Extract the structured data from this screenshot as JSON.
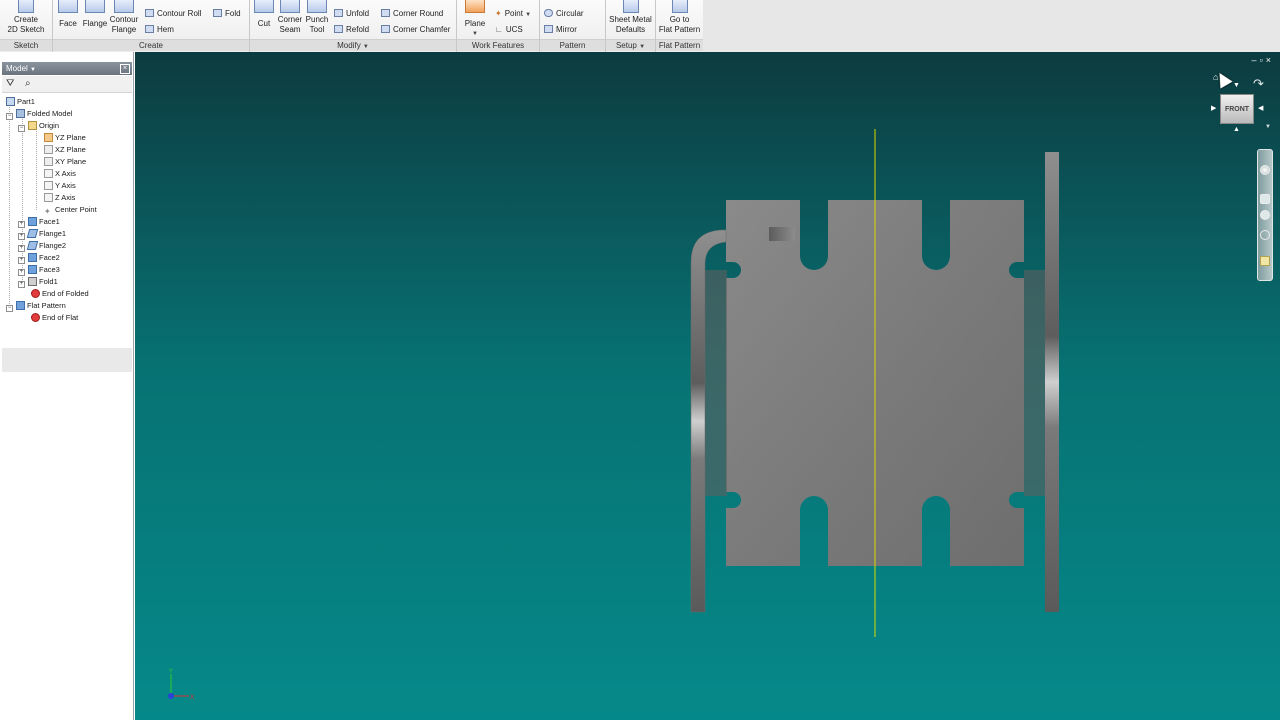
{
  "ribbon": {
    "sketch": {
      "title": "Sketch",
      "create_2d_sketch": "Create\n2D Sketch"
    },
    "create": {
      "title": "Create",
      "face": "Face",
      "flange": "Flange",
      "contour_flange": "Contour\nFlange",
      "contour_roll": "Contour Roll",
      "hem": "Hem",
      "fold": "Fold"
    },
    "modify": {
      "title": "Modify",
      "cut": "Cut",
      "corner_seam": "Corner\nSeam",
      "punch_tool": "Punch\nTool",
      "unfold": "Unfold",
      "refold": "Refold",
      "corner_round": "Corner Round",
      "corner_chamfer": "Corner Chamfer"
    },
    "work_features": {
      "title": "Work Features",
      "plane": "Plane",
      "point": "Point",
      "ucs": "UCS"
    },
    "pattern": {
      "title": "Pattern",
      "circular": "Circular",
      "mirror": "Mirror"
    },
    "setup": {
      "title": "Setup",
      "sheet_metal_defaults": "Sheet Metal\nDefaults"
    },
    "flat_pattern": {
      "title": "Flat Pattern",
      "go_to_flat_pattern": "Go to\nFlat Pattern"
    }
  },
  "browser": {
    "title": "Model",
    "tree": [
      {
        "label": "Part1",
        "icon": "part-icon"
      },
      {
        "label": "Folded Model",
        "icon": "folded-model-icon"
      },
      {
        "label": "Origin",
        "icon": "folder-icon"
      },
      {
        "label": "YZ Plane",
        "icon": "plane-icon"
      },
      {
        "label": "XZ Plane",
        "icon": "plane-icon"
      },
      {
        "label": "XY Plane",
        "icon": "plane-icon"
      },
      {
        "label": "X Axis",
        "icon": "axis-icon"
      },
      {
        "label": "Y Axis",
        "icon": "axis-icon"
      },
      {
        "label": "Z Axis",
        "icon": "axis-icon"
      },
      {
        "label": "Center Point",
        "icon": "point-icon"
      },
      {
        "label": "Face1",
        "icon": "face-icon"
      },
      {
        "label": "Flange1",
        "icon": "flange-icon"
      },
      {
        "label": "Flange2",
        "icon": "flange-icon"
      },
      {
        "label": "Face2",
        "icon": "face-icon"
      },
      {
        "label": "Face3",
        "icon": "face-icon"
      },
      {
        "label": "Fold1",
        "icon": "fold-icon"
      },
      {
        "label": "End of Folded",
        "icon": "end-of-part-icon"
      },
      {
        "label": "Flat Pattern",
        "icon": "flat-pattern-icon"
      },
      {
        "label": "End of Flat",
        "icon": "end-of-part-icon"
      }
    ]
  },
  "viewcube": {
    "face_label": "FRONT"
  },
  "colors": {
    "viewport_top": "#0c3b3f",
    "viewport_bottom": "#06898a",
    "part_gray": "#7a7a7a",
    "sketch_line": "#d8d800"
  }
}
